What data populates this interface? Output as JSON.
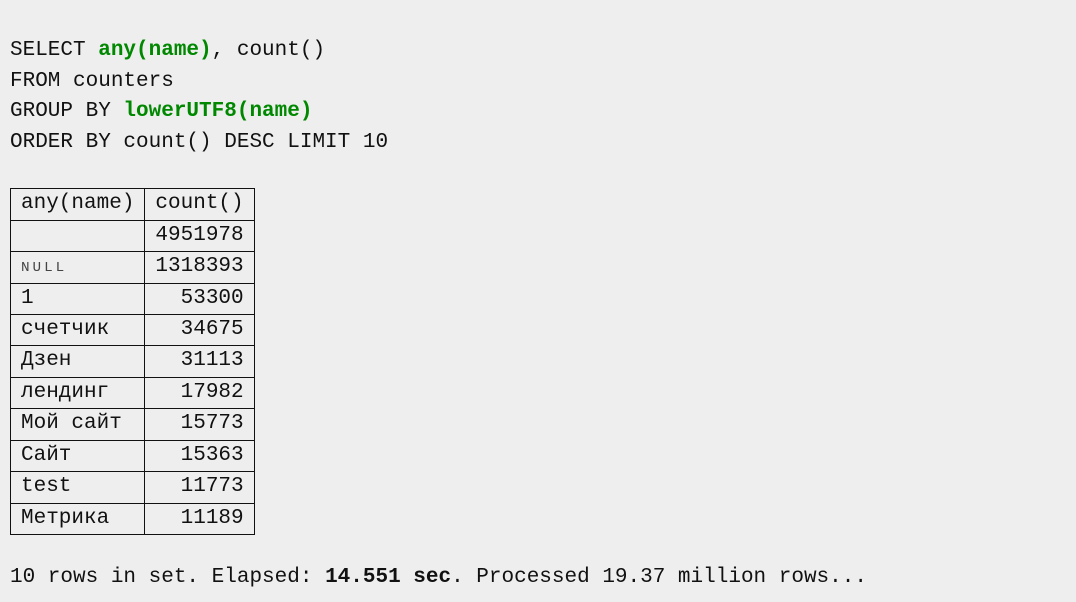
{
  "query": {
    "line1": {
      "select": "SELECT ",
      "fn1": "any(name)",
      "comma": ", count()"
    },
    "line2": "FROM counters",
    "line3": {
      "groupby": "GROUP BY ",
      "fn2": "lowerUTF8(name)"
    },
    "line4": "ORDER BY count() DESC LIMIT 10"
  },
  "table": {
    "headers": {
      "col1": "any(name)",
      "col2": "count()"
    },
    "rows": [
      {
        "name": "",
        "is_null": false,
        "count": "4951978"
      },
      {
        "name": "ᴺᵁᴸᴸ",
        "is_null": true,
        "count": "1318393"
      },
      {
        "name": "1",
        "is_null": false,
        "count": "53300"
      },
      {
        "name": "счетчик",
        "is_null": false,
        "count": "34675"
      },
      {
        "name": "Дзен",
        "is_null": false,
        "count": "31113"
      },
      {
        "name": "лендинг",
        "is_null": false,
        "count": "17982"
      },
      {
        "name": "Мой сайт",
        "is_null": false,
        "count": "15773"
      },
      {
        "name": "Сайт",
        "is_null": false,
        "count": "15363"
      },
      {
        "name": "test",
        "is_null": false,
        "count": "11773"
      },
      {
        "name": "Метрика",
        "is_null": false,
        "count": "11189"
      }
    ]
  },
  "footer": {
    "pre": "10 rows in set. Elapsed: ",
    "elapsed": "14.551 sec",
    "post": ". Processed 19.37 million rows..."
  }
}
